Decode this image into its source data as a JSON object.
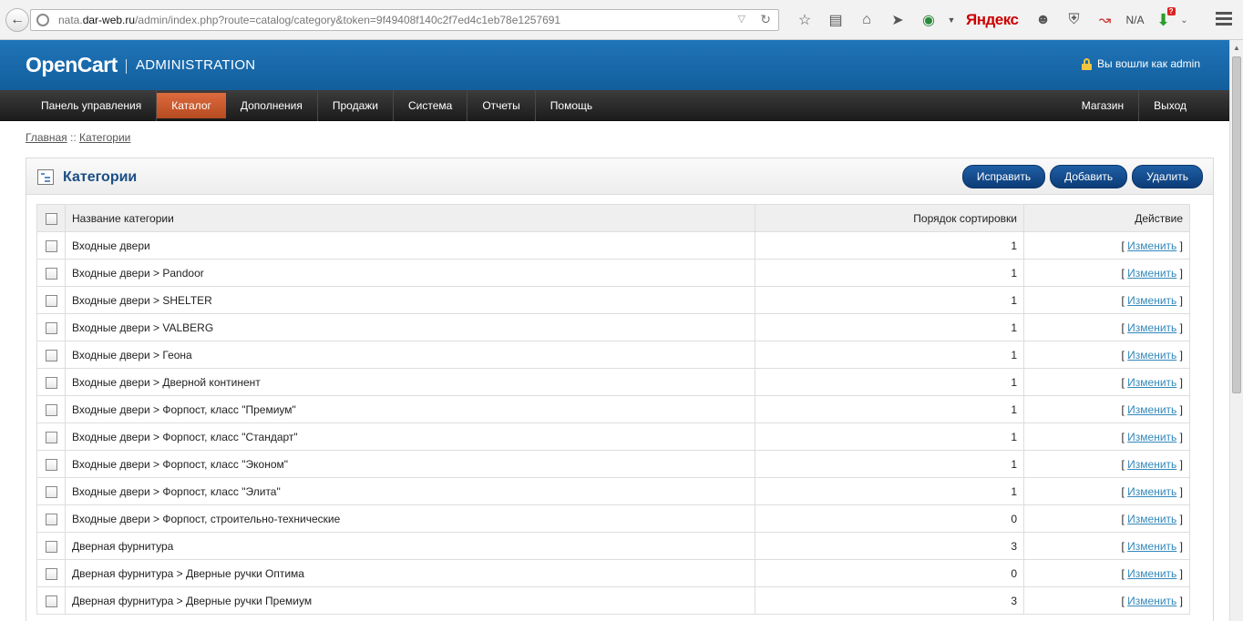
{
  "browser": {
    "url_host": "nata.dar-web.ru",
    "url_prefix": "nata.",
    "url_host_main": "dar-web.ru",
    "url_path": "/admin/index.php?route=catalog/category&token=9f49408f140c2f7ed4c1eb78e1257691",
    "yandex": "Яндекс",
    "na": "N/A",
    "badge": "?"
  },
  "header": {
    "logo": "OpenCart",
    "subtitle": "ADMINISTRATION",
    "user_text": "Вы вошли как admin"
  },
  "nav": {
    "left": [
      "Панель управления",
      "Каталог",
      "Дополнения",
      "Продажи",
      "Система",
      "Отчеты",
      "Помощь"
    ],
    "right": [
      "Магазин",
      "Выход"
    ]
  },
  "breadcrumb": {
    "home": "Главная",
    "separator": "::",
    "current": "Категории"
  },
  "box": {
    "title": "Категории",
    "buttons": [
      "Исправить",
      "Добавить",
      "Удалить"
    ]
  },
  "table": {
    "headers": [
      "Название категории",
      "Порядок сортировки",
      "Действие"
    ],
    "action_open": "[",
    "action_label": "Изменить",
    "action_close": "]",
    "rows": [
      {
        "name": "Входные двери",
        "sort": "1"
      },
      {
        "name": "Входные двери > Pandoor",
        "sort": "1"
      },
      {
        "name": "Входные двери > SHELTER",
        "sort": "1"
      },
      {
        "name": "Входные двери > VALBERG",
        "sort": "1"
      },
      {
        "name": "Входные двери > Геона",
        "sort": "1"
      },
      {
        "name": "Входные двери > Дверной континент",
        "sort": "1"
      },
      {
        "name": "Входные двери > Форпост, класс \"Премиум\"",
        "sort": "1"
      },
      {
        "name": "Входные двери > Форпост, класс \"Стандарт\"",
        "sort": "1"
      },
      {
        "name": "Входные двери > Форпост, класс \"Эконом\"",
        "sort": "1"
      },
      {
        "name": "Входные двери > Форпост, класс \"Элита\"",
        "sort": "1"
      },
      {
        "name": "Входные двери > Форпост, строительно-технические",
        "sort": "0"
      },
      {
        "name": "Дверная фурнитура",
        "sort": "3"
      },
      {
        "name": "Дверная фурнитура > Дверные ручки Оптима",
        "sort": "0"
      },
      {
        "name": "Дверная фурнитура > Дверные ручки Премиум",
        "sort": "3"
      }
    ]
  }
}
